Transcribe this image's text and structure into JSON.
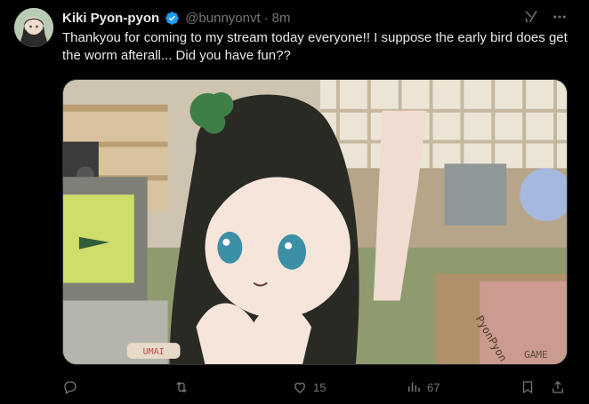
{
  "tweet": {
    "display_name": "Kiki Pyon-pyon",
    "handle": "@bunnyonvt",
    "separator": "·",
    "time": "8m",
    "text": "Thankyou for coming to my stream today everyone!! I suppose the early bird does get the worm afterall... Did you have fun??",
    "verified": true,
    "media_signs": {
      "umai": "UMAI",
      "box": "PyonPyon",
      "game": "GAME"
    }
  },
  "actions": {
    "reply_count": "",
    "retweet_count": "",
    "like_count": "15",
    "views_count": "67"
  },
  "colors": {
    "background": "#000000",
    "text": "#e7e9ea",
    "muted": "#71767b",
    "verified": "#1d9bf0"
  },
  "icons": [
    "verified-badge-icon",
    "grok-icon",
    "more-icon",
    "reply-icon",
    "retweet-icon",
    "like-icon",
    "views-icon",
    "bookmark-icon",
    "share-icon"
  ]
}
